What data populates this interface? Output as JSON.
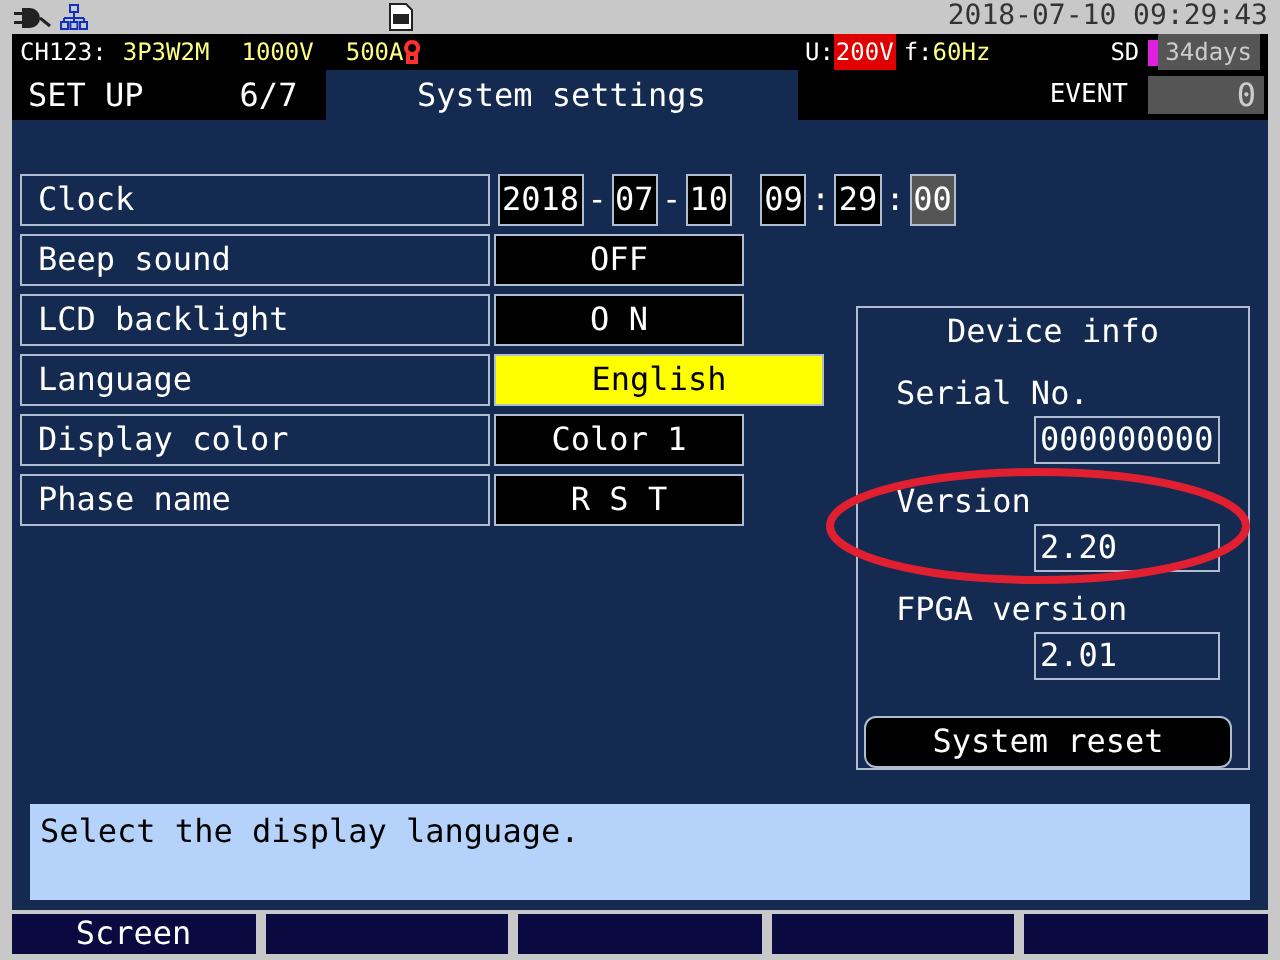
{
  "top_bar": {
    "datetime": "2018-07-10 09:29:43"
  },
  "status_bar": {
    "channel_label": "CH123:",
    "wiring": "3P3W2M",
    "voltage_range": "1000V",
    "current_range": "500A",
    "u_label": "U:",
    "nominal_voltage": "200V",
    "f_label": "f:",
    "frequency": "60Hz",
    "sd_label": "SD",
    "sd_remaining": "34days"
  },
  "header": {
    "mode": "SET UP",
    "page": "6/7",
    "title": "System settings",
    "event_label": "EVENT",
    "event_count": "0"
  },
  "clock": {
    "label": "Clock",
    "parts": [
      {
        "value": "2018",
        "separator": "-",
        "dimmed": false
      },
      {
        "value": "07",
        "separator": "-",
        "dimmed": false
      },
      {
        "value": "10",
        "dimmed": false
      },
      {
        "value": "09",
        "separator": ":",
        "dimmed": false
      },
      {
        "value": "29",
        "separator": ":",
        "dimmed": false
      },
      {
        "value": "00",
        "dimmed": true
      }
    ]
  },
  "settings": [
    {
      "label": "Beep sound",
      "value": "OFF",
      "selected": false
    },
    {
      "label": "LCD backlight",
      "value": "O N",
      "selected": false
    },
    {
      "label": "Language",
      "value": "English",
      "selected": true
    },
    {
      "label": "Display color",
      "value": "Color 1",
      "selected": false
    },
    {
      "label": "Phase name",
      "value": "R S T",
      "selected": false
    }
  ],
  "device_info": {
    "title": "Device info",
    "fields": [
      {
        "label": "Serial No.",
        "value": "000000000"
      },
      {
        "label": "Version",
        "value": "2.20"
      },
      {
        "label": "FPGA version",
        "value": "2.01"
      }
    ],
    "reset_button": "System reset"
  },
  "annotations": [
    {
      "kind": "ellipse"
    }
  ],
  "message": "Select the display language.",
  "function_keys": [
    {
      "kind": "labeled",
      "label": "Screen"
    },
    {
      "kind": "blank"
    },
    {
      "kind": "blank"
    },
    {
      "kind": "blank"
    },
    {
      "kind": "blank"
    }
  ]
}
